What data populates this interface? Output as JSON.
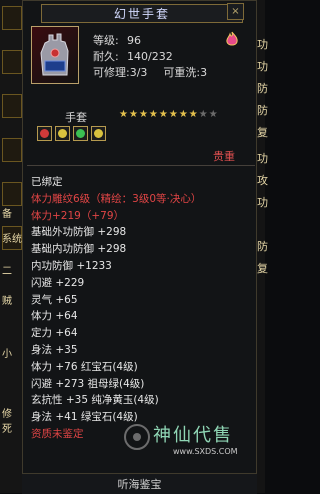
{
  "left_strip_letters": [
    "备",
    "系统",
    "二",
    "贼",
    "小",
    "修",
    "死"
  ],
  "right_strip_letters": [
    "功",
    "功",
    "防",
    "防",
    "复",
    "功",
    "攻",
    "功",
    "防",
    "复"
  ],
  "window": {
    "title": "幻世手套",
    "close_label": "×"
  },
  "item": {
    "level_label": "等级:",
    "level_value": "96",
    "durability_label": "耐久:",
    "durability_value": "140/232",
    "repair_label": "可修理:",
    "repair_value": "3/3",
    "rewash_label": "可重洗:",
    "rewash_value": "3"
  },
  "type_label": "手套",
  "stars": {
    "filled": 8,
    "total": 10
  },
  "gems": [
    "red",
    "yellow",
    "green",
    "yellow"
  ],
  "grade_label": "贵重",
  "attributes": [
    {
      "text": "已绑定",
      "color": "white"
    },
    {
      "text": "体力雕纹6级（精绘：3级0等·决心）",
      "color": "red"
    },
    {
      "text": "体力+219（+79）",
      "color": "red"
    },
    {
      "text": "基础外功防御 +298",
      "color": "white"
    },
    {
      "text": "基础内功防御 +298",
      "color": "white"
    },
    {
      "text": "内功防御 +1233",
      "color": "white"
    },
    {
      "text": "闪避 +229",
      "color": "white"
    },
    {
      "text": "灵气 +65",
      "color": "white"
    },
    {
      "text": "体力 +64",
      "color": "white"
    },
    {
      "text": "定力 +64",
      "color": "white"
    },
    {
      "text": "身法 +35",
      "color": "white"
    },
    {
      "text": "体力 +76 红宝石(4级)",
      "color": "white"
    },
    {
      "text": "闪避 +273 祖母绿(4级)",
      "color": "white"
    },
    {
      "text": "玄抗性 +35 纯净黄玉(4级)",
      "color": "white"
    },
    {
      "text": "身法 +41 绿宝石(4级)",
      "color": "white"
    },
    {
      "text": "资质未鉴定",
      "color": "red"
    }
  ],
  "watermark": {
    "text": "神仙代售",
    "url": "www.SXDS.COM"
  },
  "footer": {
    "text": "听海鉴宝"
  },
  "colors": {
    "red_attr": "#e04545",
    "gold_star": "#e3c04d",
    "frame_gold": "#b9a06a"
  }
}
